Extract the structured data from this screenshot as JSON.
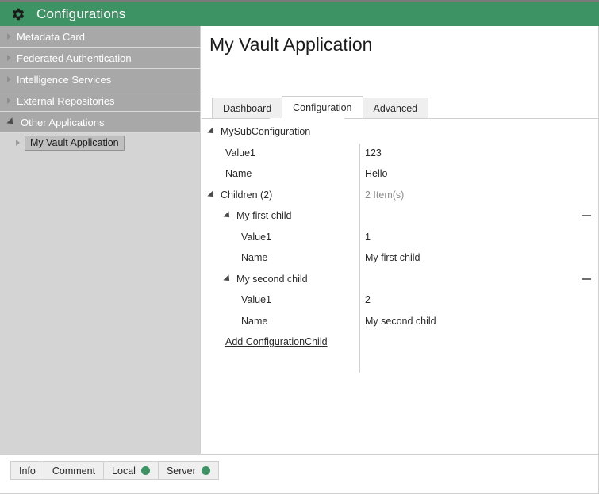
{
  "window": {
    "title": "Configurations",
    "gear_icon": "gear-icon",
    "header_color": "#3d9363"
  },
  "sidebar": {
    "items": [
      {
        "label": "Metadata Card",
        "expander": "chevron-right-icon",
        "expanded": false
      },
      {
        "label": "Federated Authentication",
        "expander": "chevron-right-icon",
        "expanded": false
      },
      {
        "label": "Intelligence Services",
        "expander": "chevron-right-icon",
        "expanded": false
      },
      {
        "label": "External Repositories",
        "expander": "chevron-right-icon",
        "expanded": false
      },
      {
        "label": "Other Applications",
        "expander": "chevron-down-icon",
        "expanded": true
      }
    ],
    "selected_child": {
      "label": "My Vault Application",
      "expander": "chevron-right-icon",
      "selected": true
    }
  },
  "main": {
    "page_title": "My Vault Application",
    "tabs": [
      {
        "label": "Dashboard",
        "active": false
      },
      {
        "label": "Configuration",
        "active": true
      },
      {
        "label": "Advanced",
        "active": false
      }
    ],
    "rows": [
      {
        "label": "MySubConfiguration",
        "value": "",
        "indent": 0,
        "expander": true,
        "muted": false,
        "remove": false
      },
      {
        "label": "Value1",
        "value": "123",
        "indent": 1,
        "expander": false,
        "muted": false,
        "remove": false
      },
      {
        "label": "Name",
        "value": "Hello",
        "indent": 1,
        "expander": false,
        "muted": false,
        "remove": false
      },
      {
        "label": "Children (2)",
        "value": "2 Item(s)",
        "indent": 0,
        "expander": true,
        "muted": true,
        "remove": false
      },
      {
        "label": "My first child",
        "value": "",
        "indent": 2,
        "expander": true,
        "muted": false,
        "remove": true
      },
      {
        "label": "Value1",
        "value": "1",
        "indent": 3,
        "expander": false,
        "muted": false,
        "remove": false
      },
      {
        "label": "Name",
        "value": "My first child",
        "indent": 3,
        "expander": false,
        "muted": false,
        "remove": false
      },
      {
        "label": "My second child",
        "value": "",
        "indent": 2,
        "expander": true,
        "muted": false,
        "remove": true
      },
      {
        "label": "Value1",
        "value": "2",
        "indent": 3,
        "expander": false,
        "muted": false,
        "remove": false
      },
      {
        "label": "Name",
        "value": "My second child",
        "indent": 3,
        "expander": false,
        "muted": false,
        "remove": false
      }
    ],
    "add_link": "Add ConfigurationChild"
  },
  "bottom": {
    "tabs": [
      {
        "label": "Info",
        "dot": false
      },
      {
        "label": "Comment",
        "dot": false
      },
      {
        "label": "Local",
        "dot": true
      },
      {
        "label": "Server",
        "dot": true
      }
    ],
    "dot_color": "#3d9363"
  }
}
